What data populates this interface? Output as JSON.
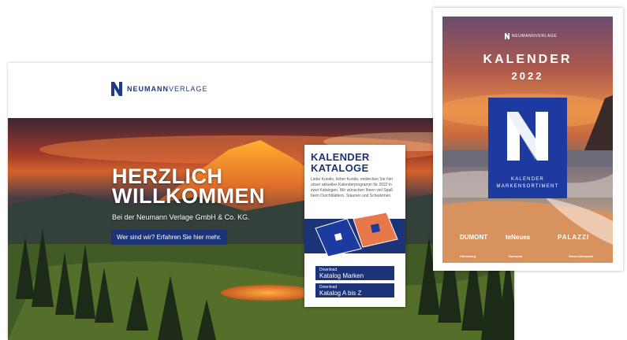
{
  "website": {
    "logo": {
      "bold": "NEUMANN",
      "light": "VERLAGE"
    },
    "hero": {
      "title_line1": "HERZLICH",
      "title_line2": "WILLKOMMEN",
      "subtitle": "Bei der Neumann Verlage GmbH & Co. KG.",
      "button_label": "Wer sind wir? Erfahren Sie hier mehr."
    },
    "catalog_card": {
      "title_line1": "KALENDER",
      "title_line2": "KATALOGE",
      "text": "Liebe Kundin, lieber Kunde, entdecken Sie hier unser aktuelles Kalenderprogramm für 2022 in zwei Katalogen. Wir wünschen Ihnen viel Spaß beim Durchblättern, Staunen und Schwärmen.",
      "downloads": [
        {
          "small": "Download",
          "label": "Katalog Marken"
        },
        {
          "small": "Download",
          "label": "Katalog A bis Z"
        }
      ]
    }
  },
  "cover": {
    "brand": "NEUMANNVERLAGE",
    "title": "KALENDER",
    "year": "2022",
    "box_line1": "KALENDER",
    "box_line2": "MARKENSORTIMENT",
    "publishers": [
      "DUMONT",
      "teNeues",
      "PALAZZI"
    ],
    "sub_publishers": [
      "Harenberg",
      "Dumonts",
      "Reise-Almanach"
    ]
  },
  "colors": {
    "brand_blue": "#1c3378",
    "cover_box_blue": "#1c3aa0"
  }
}
